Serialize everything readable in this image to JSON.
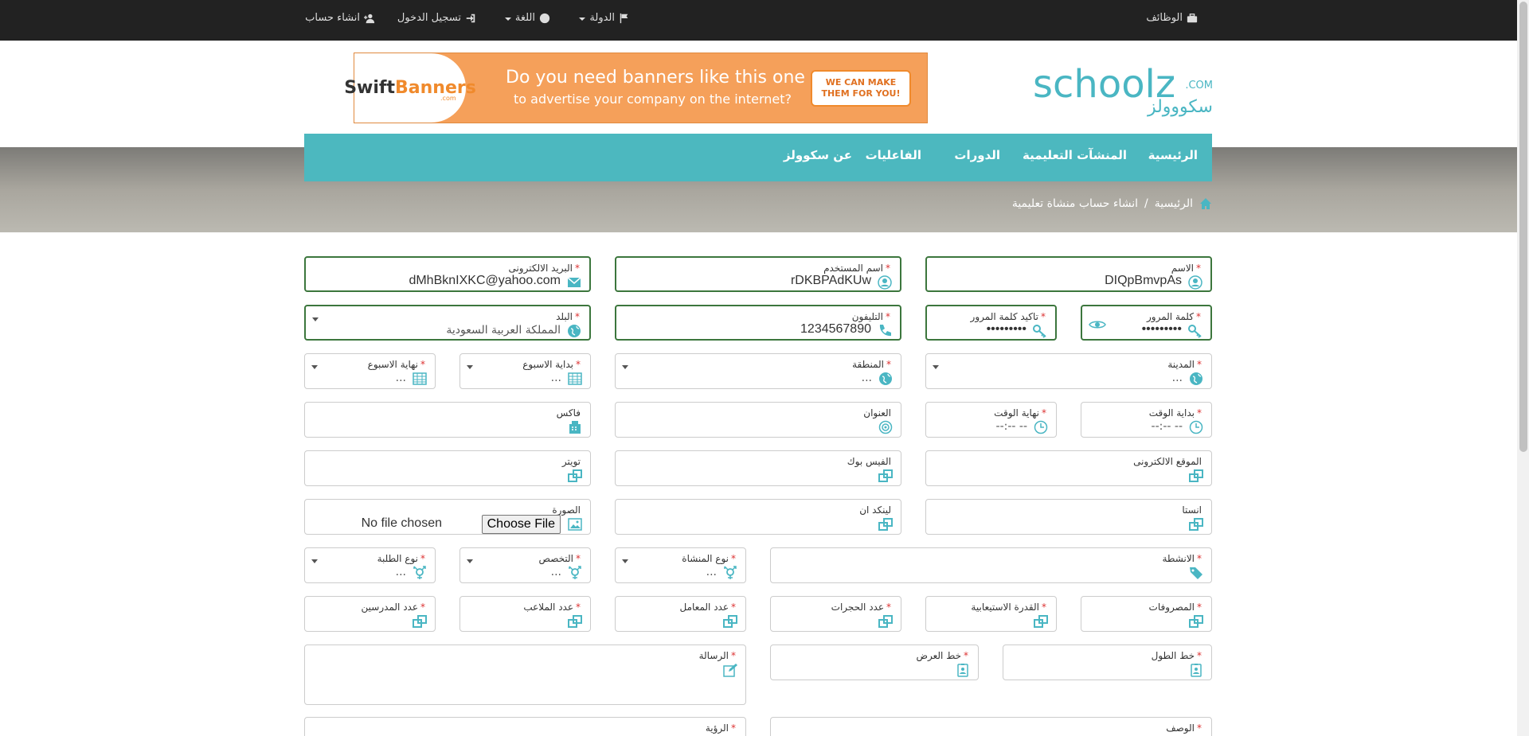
{
  "topbar": {
    "jobs": "الوظائف",
    "country": "الدولة",
    "language": "اللغة",
    "login": "تسجيل الدخول",
    "signup": "انشاء حساب"
  },
  "logo": {
    "en": "schoolz",
    "com": ".COM",
    "ar": "سكووولز"
  },
  "banner": {
    "brand_a": "Swift",
    "brand_b": "Banners",
    "brand_sub": ".com",
    "line1": "Do you need banners like this one",
    "line2": "to advertise your company on the internet?",
    "cta": "WE CAN MAKE THEM FOR YOU!"
  },
  "nav": {
    "home": "الرئيسية",
    "institutions": "المنشآت التعليمية",
    "courses": "الدورات",
    "events": "الفاعليات",
    "about": "عن سكوولز"
  },
  "breadcrumb": {
    "home": "الرئيسية",
    "sep": "/",
    "current": "انشاء حساب منشاة تعليمية"
  },
  "form": {
    "name": {
      "label": "الاسم",
      "value": "DIQpBmvpAs"
    },
    "username": {
      "label": "اسم المستخدم",
      "value": "rDKBPAdKUw"
    },
    "email": {
      "label": "البريد الالكترونى",
      "value": "dMhBknIXKC@yahoo.com"
    },
    "password": {
      "label": "كلمة المرور",
      "value": "•••••••••"
    },
    "confirm_password": {
      "label": "تاكيد كلمة المرور",
      "value": "•••••••••"
    },
    "phone": {
      "label": "التليفون",
      "value": "1234567890"
    },
    "country": {
      "label": "البلد",
      "value": "المملكة العربية السعودية"
    },
    "city": {
      "label": "المدينة",
      "value": "..."
    },
    "region": {
      "label": "المنطقة",
      "value": "..."
    },
    "week_start": {
      "label": "بداية الاسبوع",
      "value": "..."
    },
    "week_end": {
      "label": "نهاية الاسبوع",
      "value": "..."
    },
    "time_start": {
      "label": "بداية الوقت",
      "value": "--:-- --"
    },
    "time_end": {
      "label": "نهاية الوقت",
      "value": "--:-- --"
    },
    "address": {
      "label": "العنوان"
    },
    "fax": {
      "label": "فاكس"
    },
    "website": {
      "label": "الموقع الالكترونى"
    },
    "facebook": {
      "label": "الفيس بوك"
    },
    "twitter": {
      "label": "تويتر"
    },
    "instagram": {
      "label": "انستا"
    },
    "linkedin": {
      "label": "لينكد ان"
    },
    "image": {
      "label": "الصورة",
      "button": "Choose File",
      "status": "No file chosen"
    },
    "activities": {
      "label": "الانشطة"
    },
    "institution_type": {
      "label": "نوع المنشاة",
      "value": "..."
    },
    "specialization": {
      "label": "التخصص",
      "value": "..."
    },
    "students_type": {
      "label": "نوع الطلبة",
      "value": "..."
    },
    "expenses": {
      "label": "المصروفات"
    },
    "capacity": {
      "label": "القدرة الاستيعابية"
    },
    "rooms": {
      "label": "عدد الحجرات"
    },
    "labs": {
      "label": "عدد المعامل"
    },
    "fields": {
      "label": "عدد الملاعب"
    },
    "teachers": {
      "label": "عدد المدرسين"
    },
    "longitude": {
      "label": "خط الطول"
    },
    "latitude": {
      "label": "خط العرض"
    },
    "message": {
      "label": "الرسالة"
    },
    "description": {
      "label": "الوصف"
    },
    "vision": {
      "label": "الرؤية"
    }
  },
  "colors": {
    "accent": "#4cb8bf",
    "topbar": "#222222",
    "valid_border": "#3c763d",
    "required": "#dd3333"
  }
}
